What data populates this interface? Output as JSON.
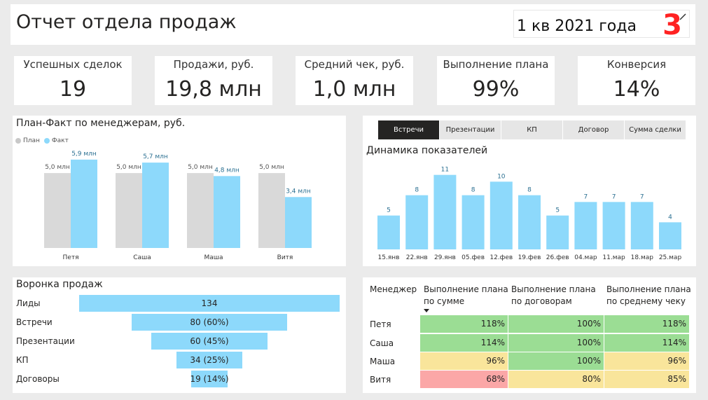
{
  "header": {
    "title": "Отчет отдела продаж",
    "period_label": "1 кв 2021 года",
    "period_badge": "3"
  },
  "kpis": [
    {
      "label": "Успешных сделок",
      "value": "19"
    },
    {
      "label": "Продажи, руб.",
      "value": "19,8 млн"
    },
    {
      "label": "Средний чек, руб.",
      "value": "1,0 млн"
    },
    {
      "label": "Выполнение плана",
      "value": "99%"
    },
    {
      "label": "Конверсия",
      "value": "14%"
    }
  ],
  "plan_fact": {
    "title": "План-Факт по менеджерам, руб.",
    "legend_plan": "План",
    "legend_fact": "Факт",
    "colors": {
      "plan": "#d9d9d9",
      "fact": "#8dd9fb"
    }
  },
  "dynamics": {
    "title": "Динамика показателей",
    "tabs": [
      "Встречи",
      "Презентации",
      "КП",
      "Договор",
      "Сумма сделки"
    ],
    "active_tab": 0
  },
  "chart_data": [
    {
      "type": "bar",
      "title": "План-Факт по менеджерам, руб.",
      "categories": [
        "Петя",
        "Саша",
        "Маша",
        "Витя"
      ],
      "series": [
        {
          "name": "План",
          "values": [
            5.0,
            5.0,
            5.0,
            5.0
          ],
          "labels": [
            "5,0 млн",
            "5,0 млн",
            "5,0 млн",
            "5,0 млн"
          ]
        },
        {
          "name": "Факт",
          "values": [
            5.9,
            5.7,
            4.8,
            3.4
          ],
          "labels": [
            "5,9 млн",
            "5,7 млн",
            "4,8 млн",
            "3,4 млн"
          ]
        }
      ],
      "ylim": [
        0,
        6.5
      ]
    },
    {
      "type": "bar",
      "title": "Динамика показателей",
      "categories": [
        "15.янв",
        "22.янв",
        "29.янв",
        "05.фев",
        "12.фев",
        "19.фев",
        "26.фев",
        "04.мар",
        "11.мар",
        "18.мар",
        "25.мар"
      ],
      "values": [
        5,
        8,
        11,
        8,
        10,
        8,
        5,
        7,
        7,
        7,
        4
      ],
      "ylim": [
        0,
        12
      ]
    }
  ],
  "funnel": {
    "title": "Воронка продаж",
    "stages": [
      {
        "label": "Лиды",
        "value": 134,
        "text": "134"
      },
      {
        "label": "Встречи",
        "value": 80,
        "text": "80 (60%)"
      },
      {
        "label": "Презентации",
        "value": 60,
        "text": "60 (45%)"
      },
      {
        "label": "КП",
        "value": 34,
        "text": "34 (25%)"
      },
      {
        "label": "Договоры",
        "value": 19,
        "text": "19 (14%)"
      }
    ]
  },
  "matrix": {
    "headers": {
      "manager": "Менеджер",
      "by_sum_1": "Выполнение плана",
      "by_sum_2": "по сумме",
      "by_contracts_1": "Выполнение плана",
      "by_contracts_2": "по договорам",
      "by_check_1": "Выполнение плана",
      "by_check_2": "по среднему чеку"
    },
    "rows": [
      {
        "name": "Петя",
        "cells": [
          {
            "text": "118%",
            "status": "green"
          },
          {
            "text": "100%",
            "status": "green"
          },
          {
            "text": "118%",
            "status": "green"
          }
        ]
      },
      {
        "name": "Саша",
        "cells": [
          {
            "text": "114%",
            "status": "green"
          },
          {
            "text": "100%",
            "status": "green"
          },
          {
            "text": "114%",
            "status": "green"
          }
        ]
      },
      {
        "name": "Маша",
        "cells": [
          {
            "text": "96%",
            "status": "yellow"
          },
          {
            "text": "100%",
            "status": "green"
          },
          {
            "text": "96%",
            "status": "yellow"
          }
        ]
      },
      {
        "name": "Витя",
        "cells": [
          {
            "text": "68%",
            "status": "red"
          },
          {
            "text": "80%",
            "status": "yellow"
          },
          {
            "text": "85%",
            "status": "yellow"
          }
        ]
      }
    ],
    "colors": {
      "green": "#9bdd94",
      "yellow": "#f9e59b",
      "red": "#fba7a7"
    }
  }
}
